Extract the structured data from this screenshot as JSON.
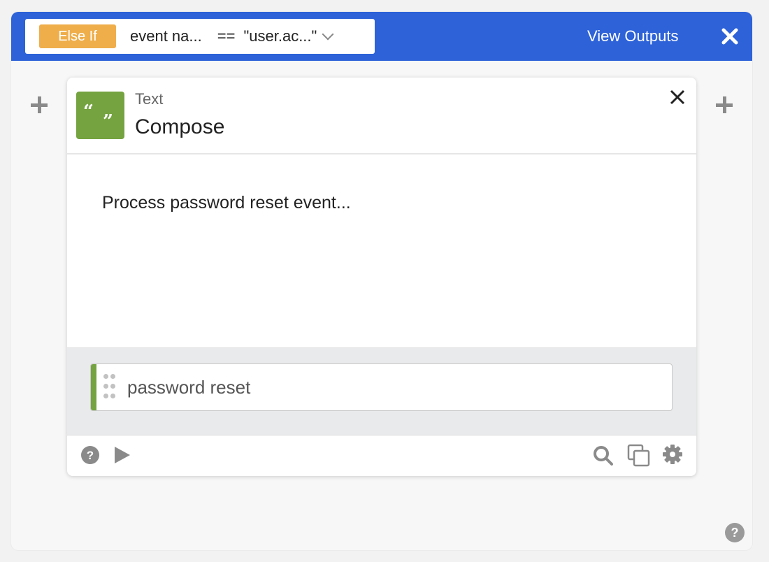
{
  "header": {
    "condition_type": "Else If",
    "condition_left": "event na...",
    "condition_operator": "==",
    "condition_right": "\"user.ac...\"",
    "view_outputs_label": "View Outputs",
    "close_icon": "close-x-icon",
    "background_color": "#2d62d8"
  },
  "step": {
    "type": "Text",
    "title": "Compose",
    "icon": "quote-icon",
    "icon_color": "#74a33f",
    "content_text": "Process password reset event...",
    "input_value": "password reset"
  },
  "footer": {
    "left_icons": [
      "help-icon",
      "play-icon"
    ],
    "right_icons": [
      "search-icon",
      "copy-icon",
      "gear-icon"
    ]
  },
  "colors": {
    "else_if_badge": "#efae4a",
    "accent_green": "#74a33f"
  }
}
